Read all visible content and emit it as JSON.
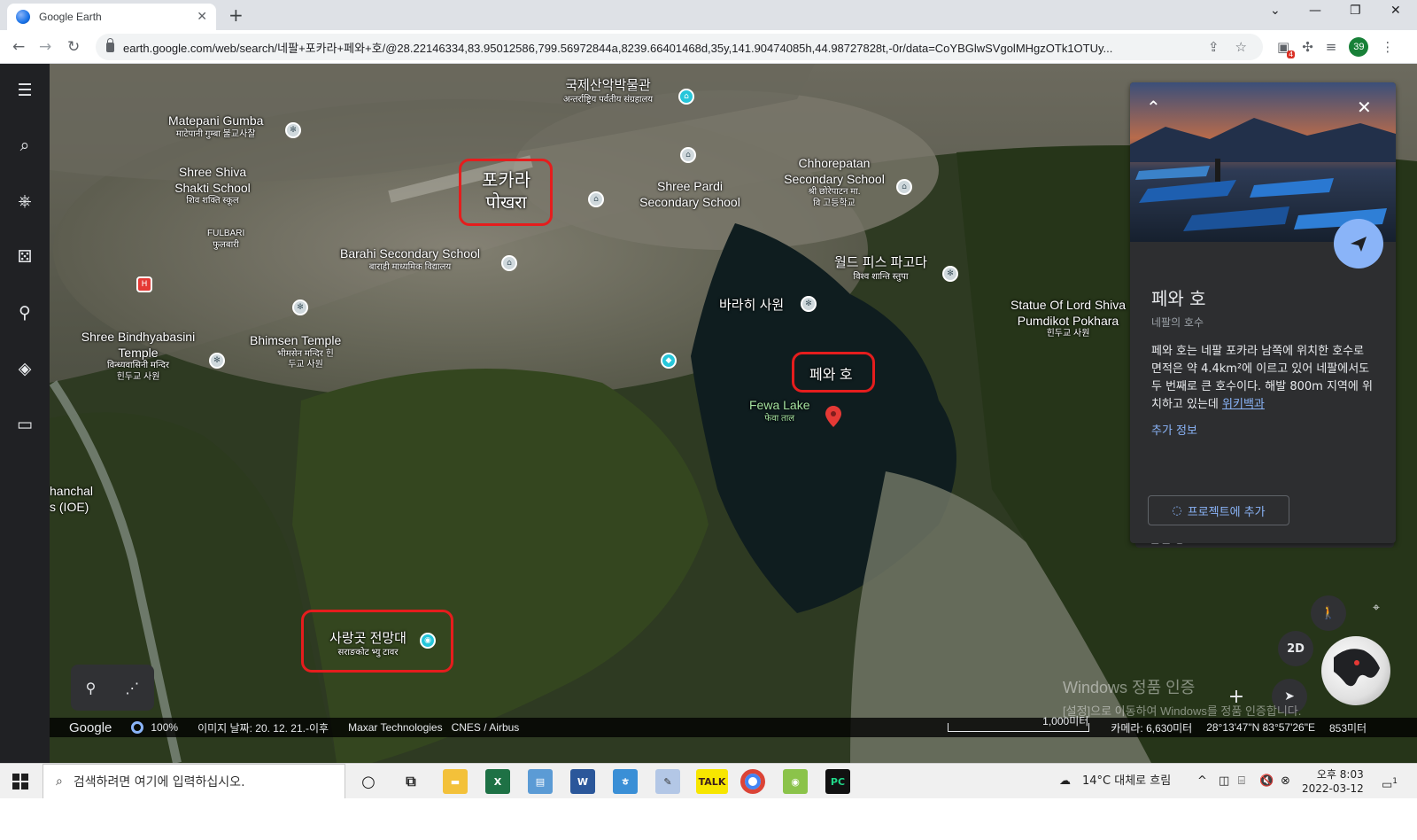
{
  "browser": {
    "tab_title": "Google Earth",
    "url": "earth.google.com/web/search/네팔+포카라+페와+호/@28.22146334,83.95012586,799.56972844a,8239.66401468d,35y,141.90474085h,44.98727828t,-0r/data=CoYBGlwSVgolMHgzOTk1OTUy...",
    "profile_initials": "39",
    "extension_badge": "4"
  },
  "map": {
    "labels": [
      {
        "name": "국제산악박물관",
        "sub": "अन्तर्राष्ट्रिय पर्वतीय संग्रहालय"
      },
      {
        "name": "Matepani Gumba",
        "sub": "माटेपानी गुम्बा 불교사찰"
      },
      {
        "name": "Shree Shiva Shakti School",
        "sub": "शिव शक्ति स्कूल"
      },
      {
        "name": "FULBARI",
        "sub": "फुलबारी"
      },
      {
        "name": "포카라",
        "sub": "पोखरा"
      },
      {
        "name": "Shree Pardi Secondary School",
        "sub": ""
      },
      {
        "name": "Chhorepatan Secondary School",
        "sub": "श्री छोरेपाटन मा. वि 고등학교"
      },
      {
        "name": "Barahi Secondary School",
        "sub": "बाराही माध्यमिक विद्यालय"
      },
      {
        "name": "월드 피스 파고다",
        "sub": "विश्व शान्ति स्तुपा"
      },
      {
        "name": "바라히 사원",
        "sub": ""
      },
      {
        "name": "Statue Of Lord Shiva Pumdikot Pokhara",
        "sub": "힌두교 사원"
      },
      {
        "name": "Shree Bindhyabasini Temple",
        "sub": "विन्ध्यवासिनी मन्दिर 힌두교 사원"
      },
      {
        "name": "Bhimsen Temple",
        "sub": "भीमसेन मन्दिर 힌두교 사원"
      },
      {
        "name": "페와 호",
        "sub": ""
      },
      {
        "name": "Fewa Lake",
        "sub": "फेवा ताल"
      },
      {
        "name": "hanchal",
        "sub": ""
      },
      {
        "name": "s (IOE)",
        "sub": ""
      },
      {
        "name": "사랑곳 전망대",
        "sub": "सराङकोट भ्यु टावर"
      }
    ]
  },
  "card": {
    "title": "페와 호",
    "subtitle": "네팔의 호수",
    "description": "페와 호는 네팔 포카라 남쪽에 위치한 호수로 면적은 약 4.4km²에 이르고 있어 네팔에서도 두 번째로 큰 호수이다. 해발 800m 지역에 위치하고 있는데",
    "wiki_link": "위키백과",
    "more_info": "추가 정보",
    "add_to_project": "프로젝트에 추가",
    "related_places": "관련 장소"
  },
  "controls": {
    "mode_2d": "2D"
  },
  "watermark": {
    "line1": "Windows 정품 인증",
    "line2": "[설정]으로 이동하여 Windows를 정품 인증합니다."
  },
  "status": {
    "brand": "Google",
    "load_percent": "100%",
    "image_date": "이미지 날짜: 20. 12. 21.-이후",
    "credit1": "Maxar Technologies",
    "credit2": "CNES / Airbus",
    "scale": "1,000미터",
    "camera": "카메라: 6,630미터",
    "coords": "28°13'47\"N 83°57'26\"E",
    "elevation": "853미터"
  },
  "taskbar": {
    "search_placeholder": "검색하려면 여기에 입력하십시오.",
    "weather": "14°C  대체로 흐림",
    "time": "오후 8:03",
    "date": "2022-03-12",
    "notification_count": "1"
  }
}
